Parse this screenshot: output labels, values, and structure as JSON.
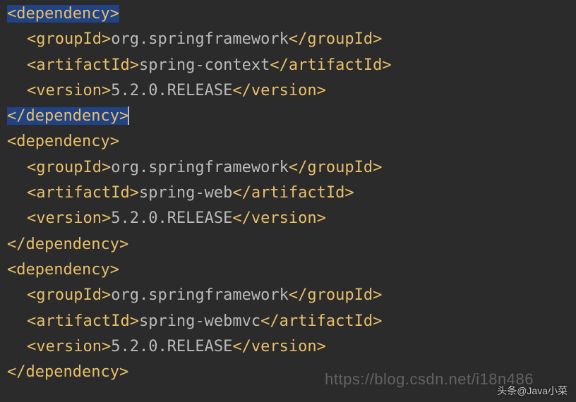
{
  "tags": {
    "dependency_open": "dependency",
    "dependency_close": "dependency",
    "groupId_open": "groupId",
    "groupId_close": "groupId",
    "artifactId_open": "artifactId",
    "artifactId_close": "artifactId",
    "version_open": "version",
    "version_close": "version"
  },
  "dependencies": [
    {
      "groupId": "org.springframework",
      "artifactId": "spring-context",
      "version": "5.2.0.RELEASE"
    },
    {
      "groupId": "org.springframework",
      "artifactId": "spring-web",
      "version": "5.2.0.RELEASE"
    },
    {
      "groupId": "org.springframework",
      "artifactId": "spring-webmvc",
      "version": "5.2.0.RELEASE"
    }
  ],
  "watermarks": {
    "csdn": "https://blog.csdn.net/i18n486",
    "toutiao": "头条@Java小菜"
  }
}
